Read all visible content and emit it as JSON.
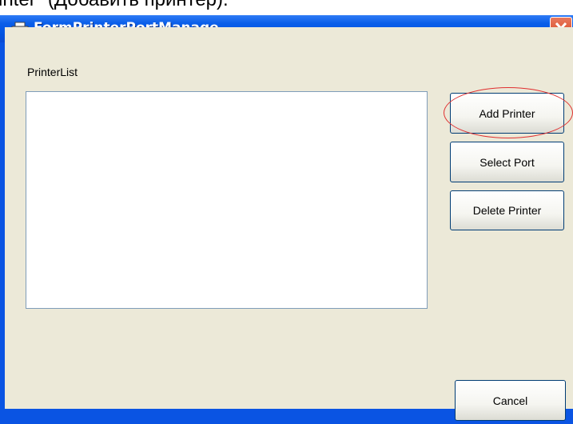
{
  "document": {
    "caption_fragment": "inter\" (Добавить принтер)."
  },
  "window": {
    "title": "FormPrinterPortManage",
    "close_glyph": "✕"
  },
  "form": {
    "printer_list_label": "PrinterList",
    "printer_list_items": []
  },
  "buttons": {
    "add_printer": "Add Printer",
    "select_port": "Select Port",
    "delete_printer": "Delete Printer",
    "cancel": "Cancel"
  },
  "icons": {
    "app": "printer-icon",
    "close": "close-icon"
  },
  "colors": {
    "titlebar": "#0053e1",
    "client_bg": "#ece9d8",
    "close_button": "#d6401a",
    "highlight": "#e03030"
  }
}
